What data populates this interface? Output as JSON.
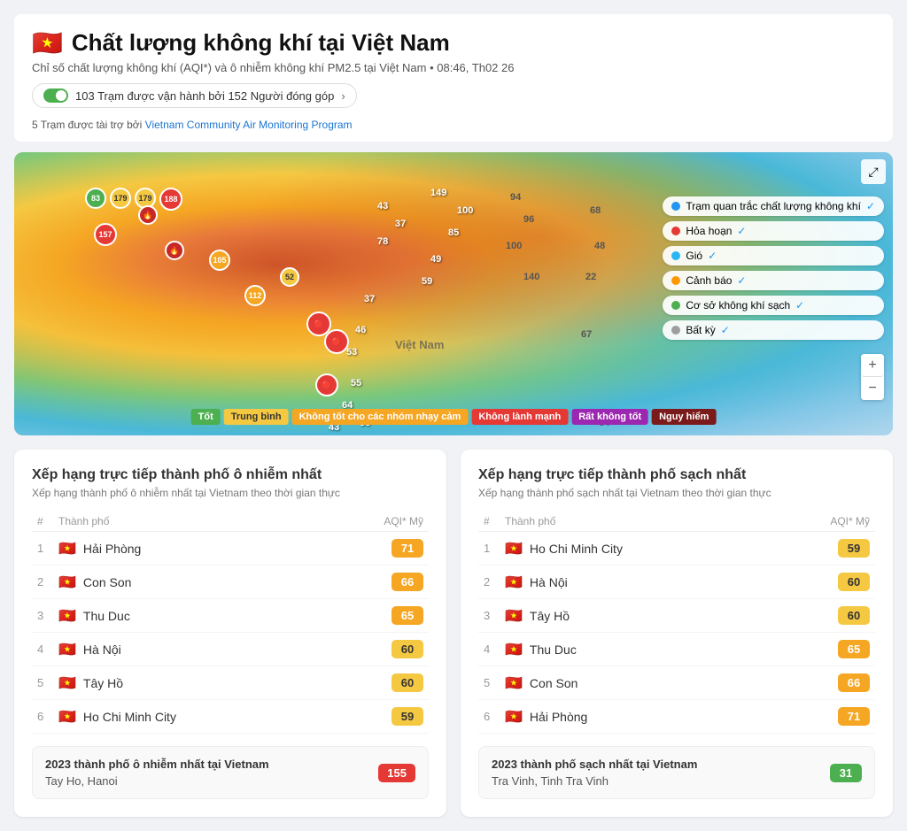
{
  "header": {
    "flag": "🇻🇳",
    "title": "Chất lượng không khí tại Việt Nam",
    "subtitle": "Chỉ số chất lượng không khí (AQI*) và ô nhiễm không khí PM2.5 tại Việt Nam • 08:46, Th02 26",
    "station_info": "103 Trạm được vận hành bởi 152 Người đóng góp",
    "sponsor_text": "5 Trạm được tài trợ bởi ",
    "sponsor_link": "Vietnam Community Air Monitoring Program"
  },
  "map": {
    "expand_label": "⤢",
    "zoom_in": "+",
    "zoom_out": "−",
    "layers": [
      {
        "id": "monitoring",
        "label": "Trạm quan trắc chất lượng không khí",
        "color": "#2196f3",
        "checked": true
      },
      {
        "id": "fire",
        "label": "Hỏa hoạn",
        "color": "#e53935",
        "checked": true
      },
      {
        "id": "wind",
        "label": "Gió",
        "color": "#29b6f6",
        "checked": true
      },
      {
        "id": "alert",
        "label": "Cảnh báo",
        "color": "#ff9800",
        "checked": true
      },
      {
        "id": "clean",
        "label": "Cơ sở không khí sạch",
        "color": "#4caf50",
        "checked": true
      },
      {
        "id": "any",
        "label": "Bất kỳ",
        "color": "#9e9e9e",
        "checked": true
      }
    ],
    "legend": [
      {
        "label": "Tốt",
        "color": "#4caf50"
      },
      {
        "label": "Trung bình",
        "color": "#f5c842"
      },
      {
        "label": "Không tốt cho các nhóm nhạy cảm",
        "color": "#f5a623"
      },
      {
        "label": "Không lành mạnh",
        "color": "#e53935"
      },
      {
        "label": "Rất không tốt",
        "color": "#9c27b0"
      },
      {
        "label": "Nguy hiểm",
        "color": "#7b1a1a"
      }
    ]
  },
  "most_polluted": {
    "title": "Xếp hạng trực tiếp thành phố ô nhiễm nhất",
    "subtitle": "Xếp hạng thành phố ô nhiễm nhất tại Vietnam theo thời gian thực",
    "col_rank": "#",
    "col_city": "Thành phố",
    "col_aqi": "AQI* Mỹ",
    "rows": [
      {
        "rank": 1,
        "flag": "🇻🇳",
        "city": "Hải Phòng",
        "aqi": 71
      },
      {
        "rank": 2,
        "flag": "🇻🇳",
        "city": "Con Son",
        "aqi": 66
      },
      {
        "rank": 3,
        "flag": "🇻🇳",
        "city": "Thu Duc",
        "aqi": 65
      },
      {
        "rank": 4,
        "flag": "🇻🇳",
        "city": "Hà Nội",
        "aqi": 60
      },
      {
        "rank": 5,
        "flag": "🇻🇳",
        "city": "Tây Hồ",
        "aqi": 60
      },
      {
        "rank": 6,
        "flag": "🇻🇳",
        "city": "Ho Chi Minh City",
        "aqi": 59
      }
    ],
    "year_label": "2023 thành phố ô nhiễm nhất tại Vietnam",
    "year_city": "Tay Ho, Hanoi",
    "year_aqi": 155
  },
  "cleanest": {
    "title": "Xếp hạng trực tiếp thành phố sạch nhất",
    "subtitle": "Xếp hạng thành phố sạch nhất tại Vietnam theo thời gian thực",
    "col_rank": "#",
    "col_city": "Thành phố",
    "col_aqi": "AQI* Mỹ",
    "rows": [
      {
        "rank": 1,
        "flag": "🇻🇳",
        "city": "Ho Chi Minh City",
        "aqi": 59
      },
      {
        "rank": 2,
        "flag": "🇻🇳",
        "city": "Hà Nội",
        "aqi": 60
      },
      {
        "rank": 3,
        "flag": "🇻🇳",
        "city": "Tây Hồ",
        "aqi": 60
      },
      {
        "rank": 4,
        "flag": "🇻🇳",
        "city": "Thu Duc",
        "aqi": 65
      },
      {
        "rank": 5,
        "flag": "🇻🇳",
        "city": "Con Son",
        "aqi": 66
      },
      {
        "rank": 6,
        "flag": "🇻🇳",
        "city": "Hải Phòng",
        "aqi": 71
      }
    ],
    "year_label": "2023 thành phố sạch nhất tại Vietnam",
    "year_city": "Tra Vinh, Tinh Tra Vinh",
    "year_aqi": 31
  }
}
